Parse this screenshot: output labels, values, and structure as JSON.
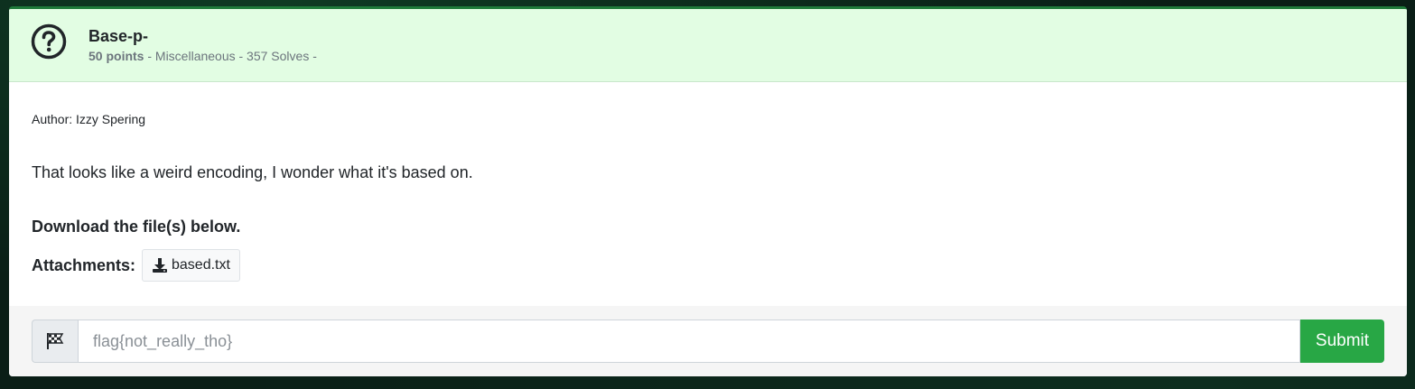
{
  "challenge": {
    "title": "Base-p-",
    "points": "50 points",
    "meta_rest": " - Miscellaneous - 357 Solves -",
    "author": "Author: Izzy Spering",
    "description": "That looks like a weird encoding, I wonder what it's based on.",
    "download_note": "Download the file(s) below.",
    "attachments_label": "Attachments:",
    "attachments": [
      {
        "name": "based.txt",
        "icon": "download-icon"
      }
    ]
  },
  "submit_form": {
    "flag_placeholder": "flag{not_really_tho}",
    "flag_value": "",
    "submit_label": "Submit",
    "addon_icon": "checkered-flag-icon"
  },
  "colors": {
    "header_bg": "#e2fde3",
    "submit_bg": "#28a745",
    "page_bg": "#0a1e16"
  }
}
